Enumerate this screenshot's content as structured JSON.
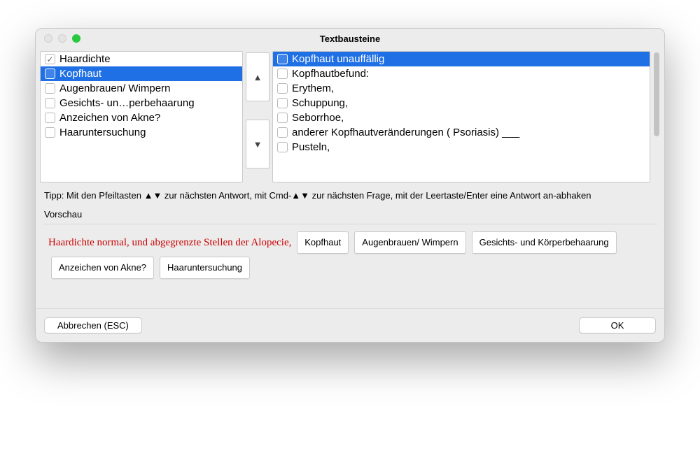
{
  "window": {
    "title": "Textbausteine"
  },
  "leftList": {
    "items": [
      {
        "label": "Haardichte",
        "checked": true,
        "selected": false
      },
      {
        "label": "Kopfhaut",
        "checked": false,
        "selected": true
      },
      {
        "label": "Augenbrauen/ Wimpern",
        "checked": false,
        "selected": false
      },
      {
        "label": "Gesichts- un…perbehaarung",
        "checked": false,
        "selected": false
      },
      {
        "label": "Anzeichen von Akne?",
        "checked": false,
        "selected": false
      },
      {
        "label": "Haaruntersuchung",
        "checked": false,
        "selected": false
      }
    ]
  },
  "rightList": {
    "items": [
      {
        "label": "Kopfhaut unauffällig",
        "checked": false,
        "selected": true
      },
      {
        "label": "Kopfhautbefund:",
        "checked": false,
        "selected": false
      },
      {
        "label": "Erythem,",
        "checked": false,
        "selected": false
      },
      {
        "label": "Schuppung,",
        "checked": false,
        "selected": false
      },
      {
        "label": "Seborrhoe,",
        "checked": false,
        "selected": false
      },
      {
        "label": "anderer Kopfhautveränderungen ( Psoriasis) ___",
        "checked": false,
        "selected": false
      },
      {
        "label": "Pusteln,",
        "checked": false,
        "selected": false
      }
    ]
  },
  "tip": "Tipp: Mit den Pfeiltasten ▲▼ zur nächsten Antwort, mit Cmd-▲▼  zur nächsten Frage, mit der Leertaste/Enter eine Antwort an-abhaken",
  "previewLabel": "Vorschau",
  "preview": {
    "redText": "Haardichte normal,  und abgegrenzte Stellen der Alopecie,",
    "chips": [
      "Kopfhaut",
      "Augenbrauen/ Wimpern",
      "Gesichts- und Körperbehaarung",
      "Anzeichen von Akne?",
      "Haaruntersuchung"
    ]
  },
  "footer": {
    "cancel": "Abbrechen (ESC)",
    "ok": "OK"
  },
  "arrows": {
    "up": "▲",
    "down": "▼"
  }
}
